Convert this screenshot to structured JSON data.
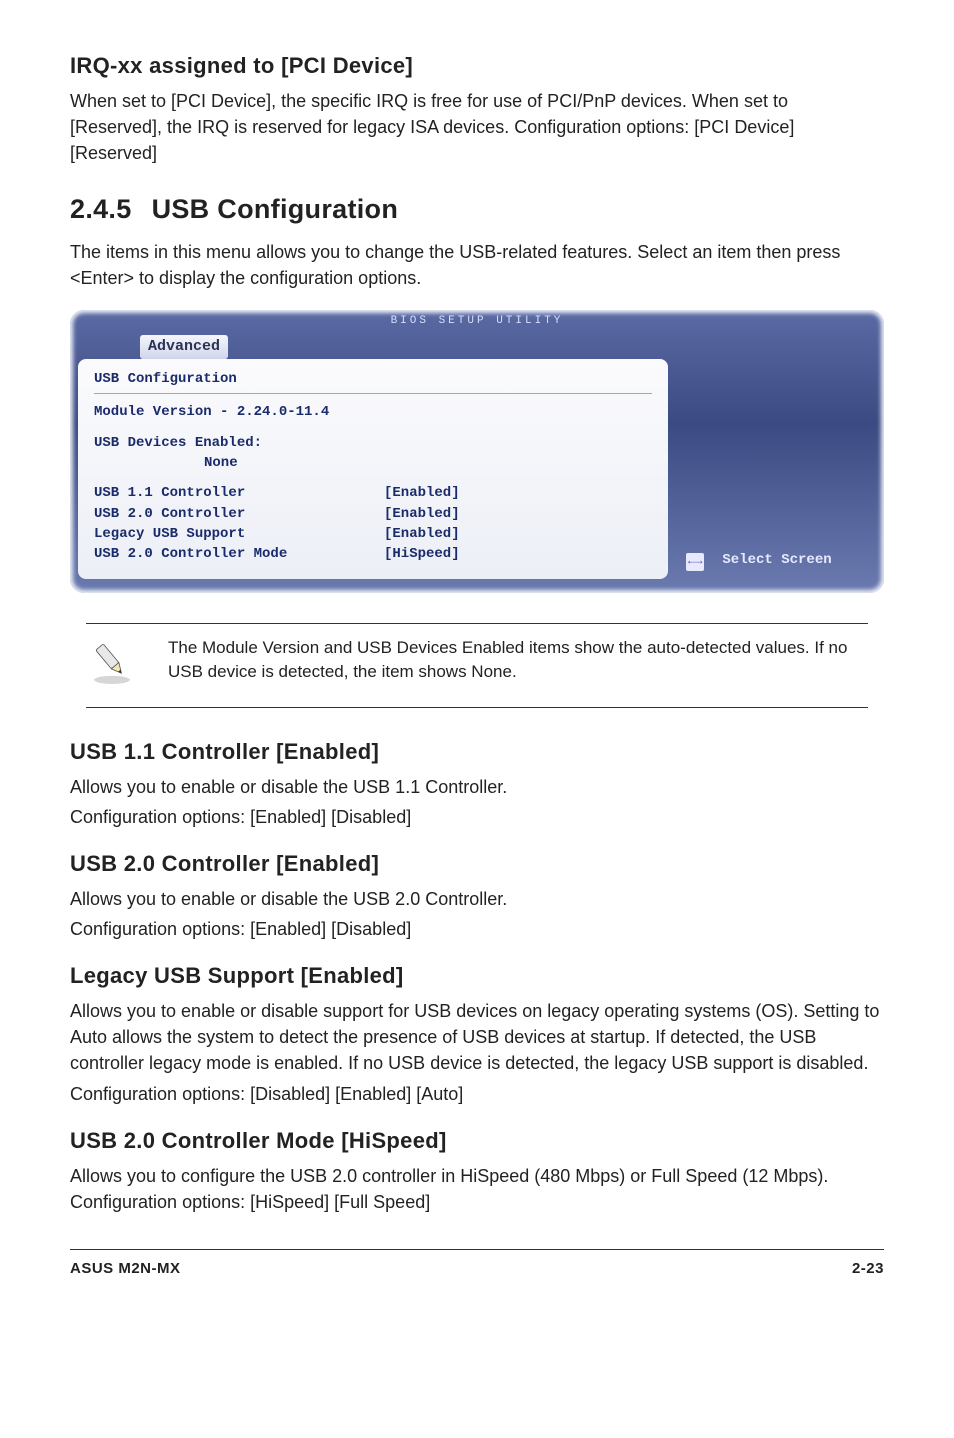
{
  "sections": {
    "irq": {
      "title": "IRQ-xx assigned to [PCI Device]",
      "body": "When set to [PCI Device], the specific IRQ is free for use of PCI/PnP devices. When set to [Reserved], the IRQ is reserved for legacy ISA devices. Configuration options: [PCI Device] [Reserved]"
    },
    "usbcfg": {
      "num": "2.4.5",
      "title": "USB Configuration",
      "intro": "The items in this menu allows you to change the USB-related features. Select an item then press <Enter> to display the configuration options."
    },
    "usb11": {
      "title": "USB 1.1 Controller [Enabled]",
      "line1": "Allows you to enable or disable the USB 1.1 Controller.",
      "line2": "Configuration options: [Enabled] [Disabled]"
    },
    "usb20": {
      "title": "USB 2.0 Controller [Enabled]",
      "line1": "Allows you to enable or disable the USB 2.0 Controller.",
      "line2": "Configuration options: [Enabled] [Disabled]"
    },
    "legacy": {
      "title": "Legacy USB Support [Enabled]",
      "body": "Allows you to enable or disable support for USB devices on legacy operating systems (OS). Setting to Auto allows the system to detect the presence of USB devices at startup. If detected, the USB controller legacy mode is enabled. If no USB device is detected, the legacy USB support is disabled.",
      "opts": "Configuration options: [Disabled] [Enabled] [Auto]"
    },
    "usb20mode": {
      "title": "USB 2.0 Controller Mode [HiSpeed]",
      "body": "Allows you to configure the USB 2.0 controller in HiSpeed (480 Mbps) or Full Speed (12 Mbps). Configuration options: [HiSpeed] [Full Speed]"
    }
  },
  "bios": {
    "title_bar": "BIOS SETUP UTILITY",
    "tab": "Advanced",
    "panel_title": "USB Configuration",
    "module": "Module Version - 2.24.0-11.4",
    "devices_label": "USB Devices Enabled:",
    "devices_value": "None",
    "rows": [
      {
        "label": "USB 1.1 Controller",
        "value": "[Enabled]"
      },
      {
        "label": "USB 2.0 Controller",
        "value": "[Enabled]"
      },
      {
        "label": "Legacy USB Support",
        "value": "[Enabled]"
      },
      {
        "label": "USB 2.0 Controller Mode",
        "value": "[HiSpeed]"
      }
    ],
    "help_arrows": "←→",
    "help_text": "Select Screen"
  },
  "note": {
    "text": "The Module Version and USB Devices Enabled items show the auto-detected values. If no USB device is detected, the item shows None."
  },
  "footer": {
    "left": "ASUS M2N-MX",
    "right": "2-23"
  }
}
